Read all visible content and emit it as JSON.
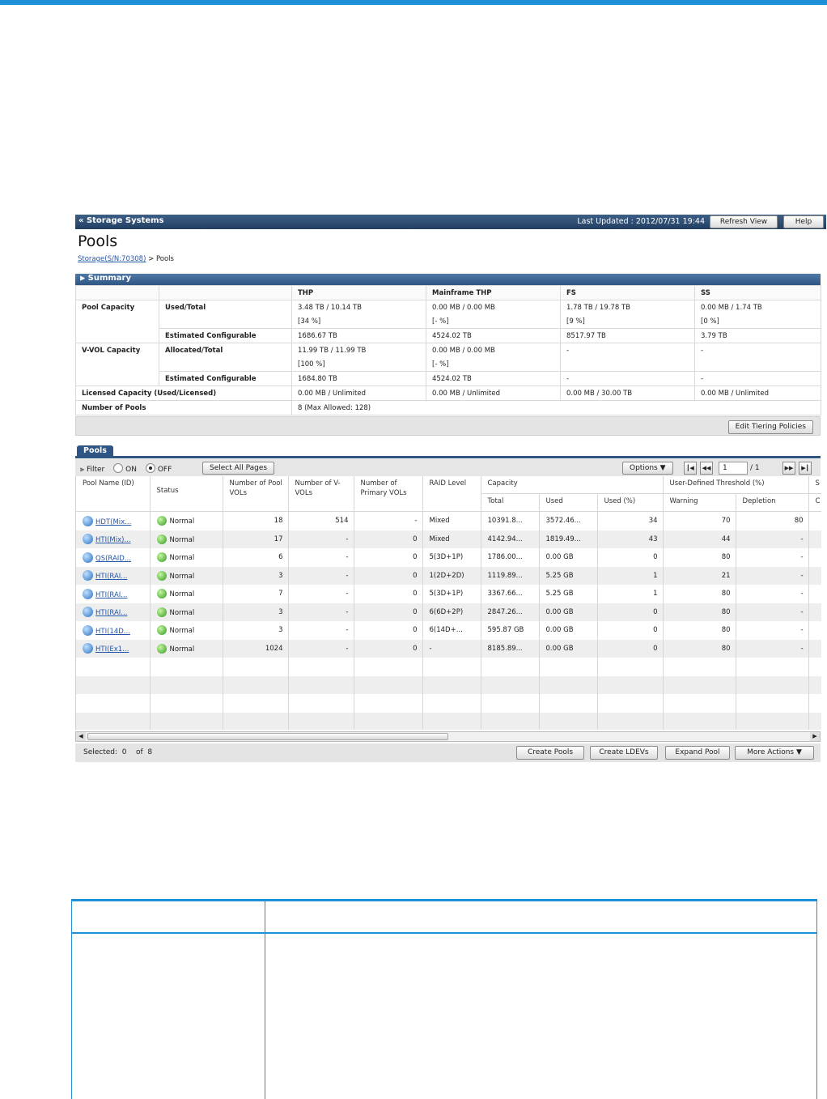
{
  "titlebar": {
    "crumb": "« Storage Systems",
    "last_updated": "Last Updated : 2012/07/31 19:44",
    "refresh_label": "Refresh View",
    "help_label": "Help"
  },
  "page_title": "Pools",
  "breadcrumb": {
    "link": "Storage(S/N:70308)",
    "rest": " > Pools"
  },
  "summary": {
    "title": "Summary",
    "columns": [
      "THP",
      "Mainframe THP",
      "FS",
      "SS"
    ],
    "rows": [
      {
        "group": "Pool Capacity",
        "sub": "Used/Total",
        "cells": [
          "3.48 TB / 10.14 TB",
          "0.00 MB / 0.00 MB",
          "1.78 TB / 19.78 TB",
          "0.00 MB / 1.74 TB"
        ]
      },
      {
        "group": "",
        "sub": "",
        "cells": [
          "[34 %]",
          "[- %]",
          "[9 %]",
          "[0 %]"
        ]
      },
      {
        "group": "",
        "sub": "Estimated Configurable",
        "cells": [
          "1686.67 TB",
          "4524.02 TB",
          "8517.97 TB",
          "3.79 TB"
        ]
      },
      {
        "group": "V-VOL Capacity",
        "sub": "Allocated/Total",
        "cells": [
          "11.99 TB / 11.99 TB",
          "0.00 MB / 0.00 MB",
          "-",
          "-"
        ]
      },
      {
        "group": "",
        "sub": "",
        "cells": [
          "[100 %]",
          "[- %]",
          "",
          ""
        ]
      },
      {
        "group": "",
        "sub": "Estimated Configurable",
        "cells": [
          "1684.80 TB",
          "4524.02 TB",
          "-",
          "-"
        ]
      },
      {
        "group": "Licensed Capacity (Used/Licensed)",
        "sub": "",
        "cells": [
          "0.00 MB / Unlimited",
          "0.00 MB / Unlimited",
          "0.00 MB / 30.00 TB",
          "0.00 MB / Unlimited"
        ]
      },
      {
        "group": "Number of Pools",
        "sub": "",
        "cells": [
          "8 (Max Allowed: 128)",
          "",
          "",
          ""
        ]
      }
    ],
    "edit_button": "Edit Tiering Policies"
  },
  "pools": {
    "tab_label": "Pools",
    "filter_label": "Filter",
    "on_label": "ON",
    "off_label": "OFF",
    "select_all_label": "Select All Pages",
    "options_label": "Options",
    "page_current": "1",
    "page_total": "/ 1",
    "group_headers": {
      "capacity": "Capacity",
      "threshold": "User-Defined Threshold (%)",
      "extra": "S"
    },
    "headers": {
      "pool_name": "Pool Name (ID)",
      "status": "Status",
      "pool_vols": "Number of Pool VOLs",
      "vvols": "Number of V-VOLs",
      "primary": "Number of Primary VOLs",
      "raid": "RAID Level",
      "total": "Total",
      "used": "Used",
      "used_pct": "Used (%)",
      "warning": "Warning",
      "depletion": "Depletion",
      "extra": "C"
    },
    "rows": [
      {
        "name": "HDT(Mix...",
        "status": "Normal",
        "pool_vols": "18",
        "vvols": "514",
        "primary": "-",
        "raid": "Mixed",
        "total": "10391.8...",
        "used": "3572.46...",
        "used_pct": "34",
        "warning": "70",
        "depletion": "80"
      },
      {
        "name": "HTI(Mix)...",
        "status": "Normal",
        "pool_vols": "17",
        "vvols": "-",
        "primary": "0",
        "raid": "Mixed",
        "total": "4142.94...",
        "used": "1819.49...",
        "used_pct": "43",
        "warning": "44",
        "depletion": "-"
      },
      {
        "name": "QS(RAID...",
        "status": "Normal",
        "pool_vols": "6",
        "vvols": "-",
        "primary": "0",
        "raid": "5(3D+1P)",
        "total": "1786.00...",
        "used": "0.00 GB",
        "used_pct": "0",
        "warning": "80",
        "depletion": "-"
      },
      {
        "name": "HTI(RAI...",
        "status": "Normal",
        "pool_vols": "3",
        "vvols": "-",
        "primary": "0",
        "raid": "1(2D+2D)",
        "total": "1119.89...",
        "used": "5.25 GB",
        "used_pct": "1",
        "warning": "21",
        "depletion": "-"
      },
      {
        "name": "HTI(RAI...",
        "status": "Normal",
        "pool_vols": "7",
        "vvols": "-",
        "primary": "0",
        "raid": "5(3D+1P)",
        "total": "3367.66...",
        "used": "5.25 GB",
        "used_pct": "1",
        "warning": "80",
        "depletion": "-"
      },
      {
        "name": "HTI(RAI...",
        "status": "Normal",
        "pool_vols": "3",
        "vvols": "-",
        "primary": "0",
        "raid": "6(6D+2P)",
        "total": "2847.26...",
        "used": "0.00 GB",
        "used_pct": "0",
        "warning": "80",
        "depletion": "-"
      },
      {
        "name": "HTI(14D...",
        "status": "Normal",
        "pool_vols": "3",
        "vvols": "-",
        "primary": "0",
        "raid": "6(14D+...",
        "total": "595.87 GB",
        "used": "0.00 GB",
        "used_pct": "0",
        "warning": "80",
        "depletion": "-"
      },
      {
        "name": "HTI(Ex1...",
        "status": "Normal",
        "pool_vols": "1024",
        "vvols": "-",
        "primary": "0",
        "raid": "-",
        "total": "8185.89...",
        "used": "0.00 GB",
        "used_pct": "0",
        "warning": "80",
        "depletion": "-"
      }
    ],
    "footer": {
      "selected_label": "Selected:",
      "selected_count": "0",
      "of_label": "of",
      "total_count": "8",
      "create_pools": "Create Pools",
      "create_ldevs": "Create LDEVs",
      "expand_pool": "Expand Pool",
      "more_actions": "More Actions"
    }
  },
  "colors": {
    "accent": "#1e90d8",
    "titlebar": "#2e5584",
    "status_ok": "#2f9a1b"
  }
}
